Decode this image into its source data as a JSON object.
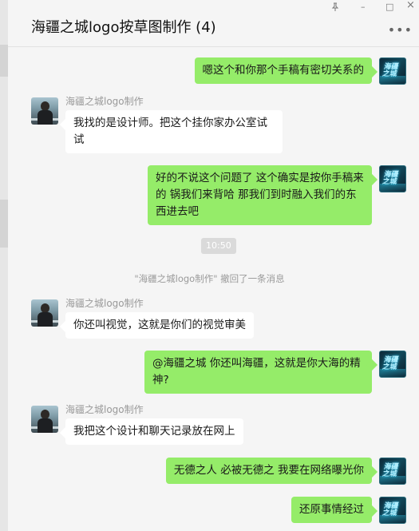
{
  "window": {
    "title": "海疆之城logo按草图制作 (4)",
    "pin_icon": "pin-icon",
    "minimize_label": "–",
    "maximize_label": "□",
    "close_label": "×",
    "more_label": "•••"
  },
  "colors": {
    "bubble_me": "#95ec69",
    "bubble_other": "#ffffff",
    "background": "#f5f5f5"
  },
  "other_sender": "海疆之城logo制作",
  "messages": [
    {
      "from": "me",
      "text": "嗯这个和你那个手稿有密切关系的"
    },
    {
      "from": "other",
      "sender": "海疆之城logo制作",
      "text": "我找的是设计师。把这个挂你家办公室试试"
    },
    {
      "from": "me",
      "text": "好的不说这个问题了  这个确实是按你手稿来的   锅我们来背哈    那我们到时融入我们的东西进去吧"
    },
    {
      "from": "other",
      "sender": "海疆之城logo制作",
      "text": "你还叫视觉，这就是你们的视觉审美"
    },
    {
      "from": "me",
      "text": "@海疆之城    你还叫海疆，这就是你大海的精神?"
    },
    {
      "from": "other",
      "sender": "海疆之城logo制作",
      "text": "我把这个设计和聊天记录放在网上"
    },
    {
      "from": "me",
      "text": "无德之人    必被无德之    我要在网络曝光你"
    },
    {
      "from": "me",
      "text": "还原事情经过"
    }
  ],
  "timestamp": "10:50",
  "system_notice": "\"海疆之城logo制作\" 撤回了一条消息"
}
